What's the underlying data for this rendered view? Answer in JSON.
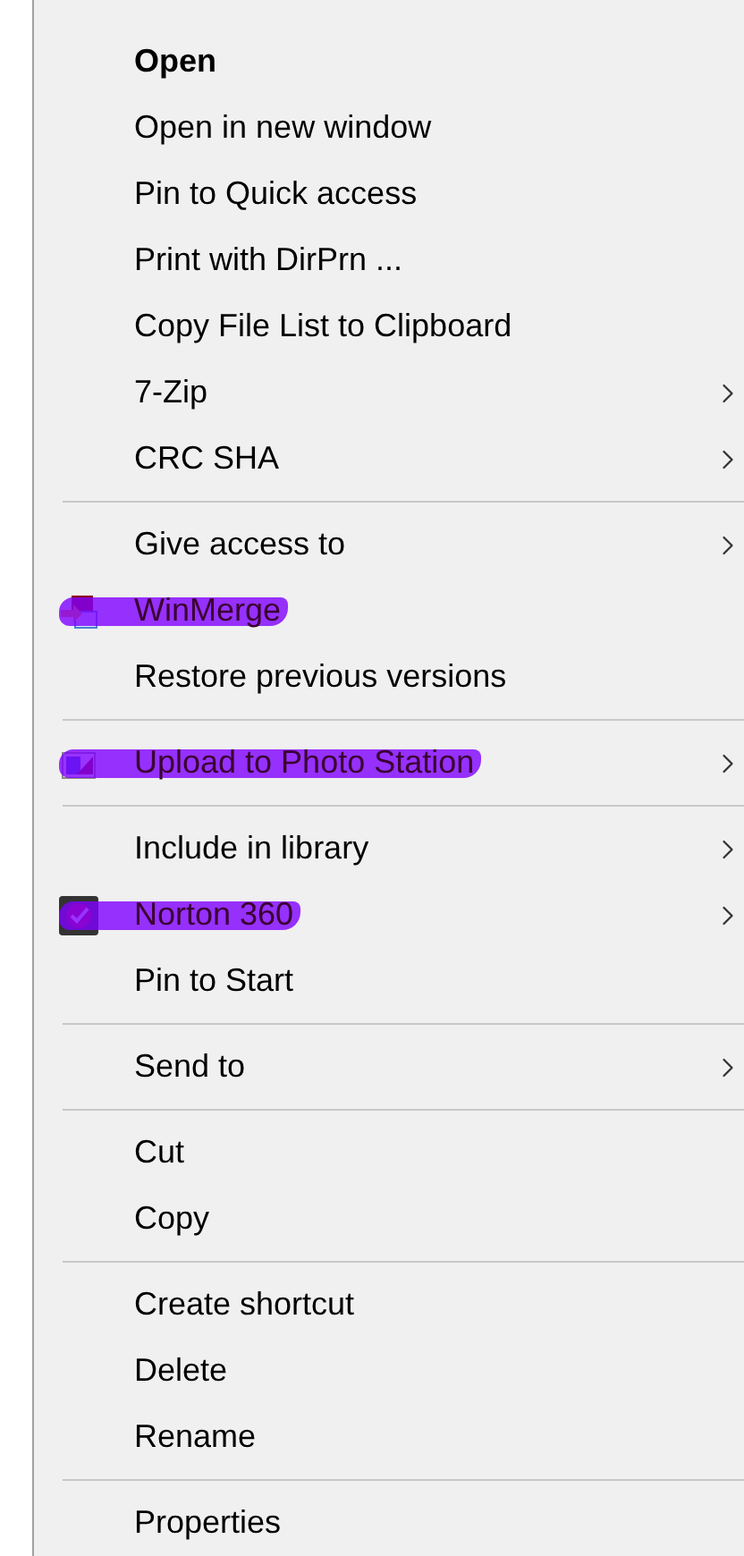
{
  "menu": {
    "sections": [
      {
        "items": [
          {
            "label": "Open",
            "default": true,
            "submenu": false,
            "marked": false
          },
          {
            "label": "Open in new window",
            "default": false,
            "submenu": false,
            "marked": false
          },
          {
            "label": "Pin to Quick access",
            "default": false,
            "submenu": false,
            "marked": false
          },
          {
            "label": "Print with DirPrn ...",
            "default": false,
            "submenu": false,
            "marked": false
          },
          {
            "label": "Copy File List to Clipboard",
            "default": false,
            "submenu": false,
            "marked": false
          },
          {
            "label": "7-Zip",
            "default": false,
            "submenu": true,
            "marked": false
          },
          {
            "label": "CRC SHA",
            "default": false,
            "submenu": true,
            "marked": false
          }
        ]
      },
      {
        "items": [
          {
            "label": "Give access to",
            "default": false,
            "submenu": true,
            "marked": false
          },
          {
            "label": "WinMerge",
            "default": false,
            "submenu": false,
            "marked": true,
            "kind": "compare"
          },
          {
            "label": "Restore previous versions",
            "default": false,
            "submenu": false,
            "marked": false
          }
        ]
      },
      {
        "items": [
          {
            "label": "Upload to Photo Station",
            "default": false,
            "submenu": true,
            "marked": true,
            "kind": "photo"
          }
        ]
      },
      {
        "items": [
          {
            "label": "Include in library",
            "default": false,
            "submenu": true,
            "marked": false
          },
          {
            "label": "Norton 360",
            "default": false,
            "submenu": true,
            "marked": true,
            "kind": "check"
          },
          {
            "label": "Pin to Start",
            "default": false,
            "submenu": false,
            "marked": false
          }
        ]
      },
      {
        "items": [
          {
            "label": "Send to",
            "default": false,
            "submenu": true,
            "marked": false
          }
        ]
      },
      {
        "items": [
          {
            "label": "Cut",
            "default": false,
            "submenu": false,
            "marked": false
          },
          {
            "label": "Copy",
            "default": false,
            "submenu": false,
            "marked": false
          }
        ]
      },
      {
        "items": [
          {
            "label": "Create shortcut",
            "default": false,
            "submenu": false,
            "marked": false
          },
          {
            "label": "Delete",
            "default": false,
            "submenu": false,
            "marked": false
          },
          {
            "label": "Rename",
            "default": false,
            "submenu": false,
            "marked": false
          }
        ]
      },
      {
        "items": [
          {
            "label": "Properties",
            "default": false,
            "submenu": false,
            "marked": false
          }
        ]
      }
    ]
  }
}
